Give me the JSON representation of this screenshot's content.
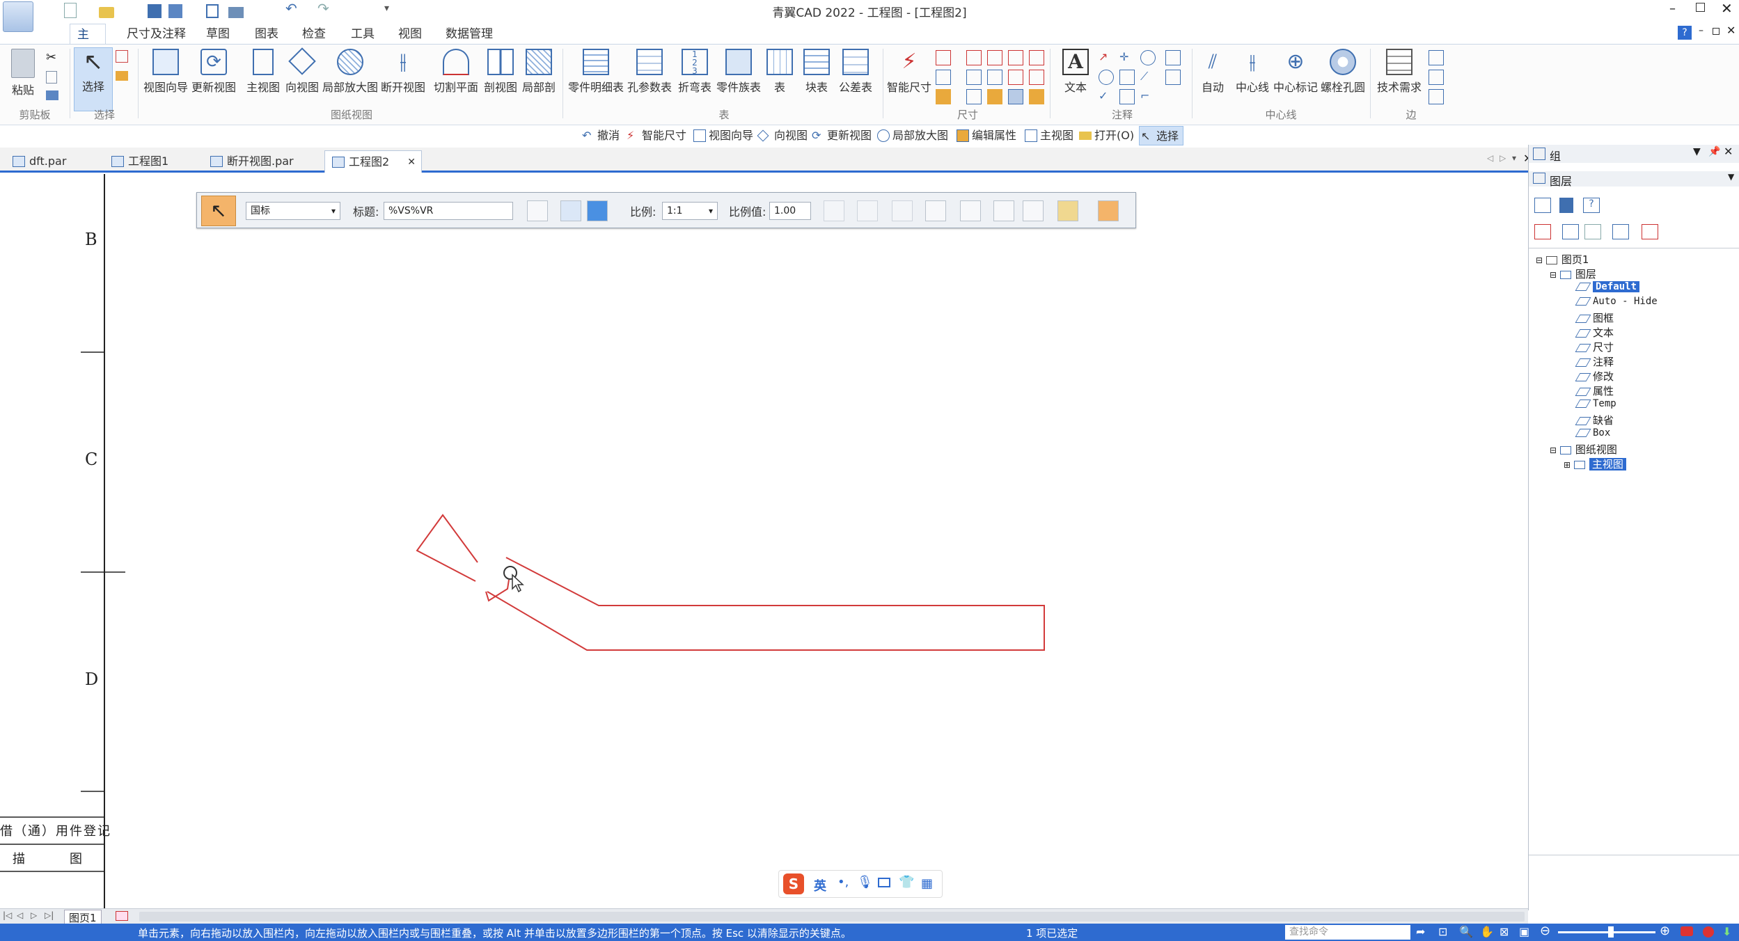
{
  "window": {
    "title": "青翼CAD 2022 - 工程图 - [工程图2]"
  },
  "ribbon_tabs": [
    "主要",
    "尺寸及注释",
    "草图",
    "图表",
    "检查",
    "工具",
    "视图",
    "数据管理"
  ],
  "ribbon": {
    "clipboard": {
      "paste": "粘贴",
      "group": "剪贴板"
    },
    "select": {
      "select": "选择",
      "group": "选择"
    },
    "drawing_views": {
      "view_wizard": "视图向导",
      "update_view": "更新视图",
      "main_view": "主视图",
      "direction_view": "向视图",
      "detail_view": "局部放大图",
      "broken_view": "断开视图",
      "cut_plane": "切割平面",
      "section_view": "剖视图",
      "partial_section": "局部剖",
      "group": "图纸视图"
    },
    "tables": {
      "parts_list": "零件明细表",
      "hole_table": "孔参数表",
      "bend_table": "折弯表",
      "part_family_table": "零件族表",
      "table": "表",
      "block_table": "块表",
      "tolerance_table": "公差表",
      "group": "表"
    },
    "dimension": {
      "smart_dim": "智能尺寸",
      "group": "尺寸"
    },
    "annotation": {
      "text": "文本",
      "group": "注释"
    },
    "centerline": {
      "auto": "自动",
      "center_line": "中心线",
      "center_mark": "中心标记",
      "bolt_circle": "螺栓孔圆",
      "group": "中心线"
    },
    "edge": {
      "tech_req": "技术需求",
      "group": "边"
    }
  },
  "command_bar": [
    "撤消",
    "智能尺寸",
    "视图向导",
    "向视图",
    "更新视图",
    "局部放大图",
    "编辑属性",
    "主视图",
    "打开(O)",
    "选择"
  ],
  "doc_tabs": [
    "dft.par",
    "工程图1",
    "断开视图.par",
    "工程图2"
  ],
  "floatbar": {
    "standard": "国标",
    "title_label": "标题:",
    "title_value": "%VS%VR",
    "scale_label": "比例:",
    "scale_value": "1:1",
    "scale_value_label": "比例值:",
    "scale_number": "1.00"
  },
  "border_letters": [
    "B",
    "C",
    "D"
  ],
  "title_block": {
    "row1": "借（通）用件登记",
    "row2_a": "描",
    "row2_b": "图"
  },
  "right_panel": {
    "top_title": "组",
    "header_title": "图层",
    "tree": {
      "page": "图页1",
      "layers_node": "图层",
      "layers": [
        "Default",
        "Auto - Hide",
        "图框",
        "文本",
        "尺寸",
        "注释",
        "修改",
        "属性",
        "Temp",
        "缺省",
        "Box"
      ],
      "views_node": "图纸视图",
      "views": [
        "主视图"
      ]
    }
  },
  "ime": {
    "lang": "英"
  },
  "page_tab": "图页1",
  "status": {
    "hint": "单击元素，向右拖动以放入围栏内，向左拖动以放入围栏内或与围栏重叠，或按 Alt 并单击以放置多边形围栏的第一个顶点。按 Esc 以清除显示的关键点。",
    "selection": "1 项已选定",
    "search_placeholder": "查找命令"
  },
  "colors": {
    "accent": "#2e6bd0",
    "sketch": "#d23a3a"
  }
}
